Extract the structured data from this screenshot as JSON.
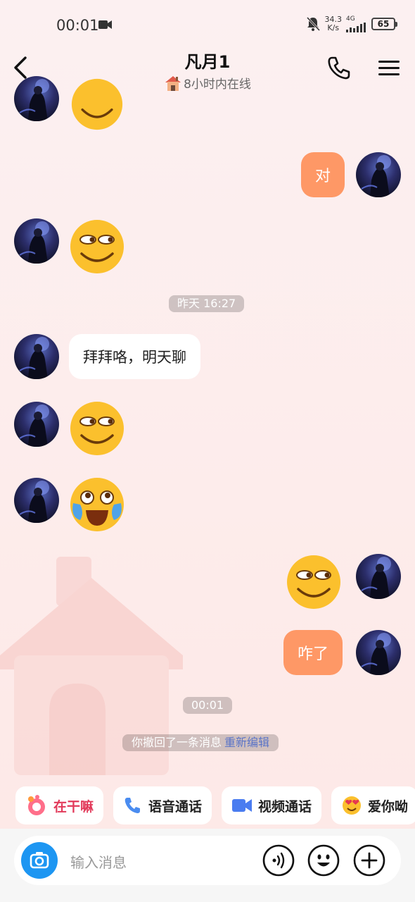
{
  "status_bar": {
    "time": "00:01",
    "net_speed_value": "34.3",
    "net_speed_unit": "K/s",
    "network": "4G",
    "battery": "65"
  },
  "header": {
    "title": "凡月1",
    "subtitle": "8小时内在线"
  },
  "messages": {
    "m1": {
      "side": "out",
      "text": "对"
    },
    "timestamp_1": "昨天 16:27",
    "m2": {
      "side": "in",
      "text": "拜拜咯，明天聊"
    },
    "m3": {
      "side": "out",
      "text": "咋了"
    },
    "timestamp_2": "00:01",
    "recall_text": "你撤回了一条消息",
    "recall_link": "重新编辑"
  },
  "quick_actions": [
    {
      "label": "在干嘛",
      "icon": "wave-sticker-icon"
    },
    {
      "label": "语音通话",
      "icon": "phone-icon"
    },
    {
      "label": "视频通话",
      "icon": "video-camera-icon"
    },
    {
      "label": "爱你呦",
      "icon": "heart-eyes-emoji-icon"
    }
  ],
  "input": {
    "placeholder": "输入消息"
  },
  "colors": {
    "outgoing_bubble": "#fe9866",
    "camera_button": "#1d96f2",
    "recall_link": "#5b74c7",
    "quick_first": "#e23a5a"
  }
}
